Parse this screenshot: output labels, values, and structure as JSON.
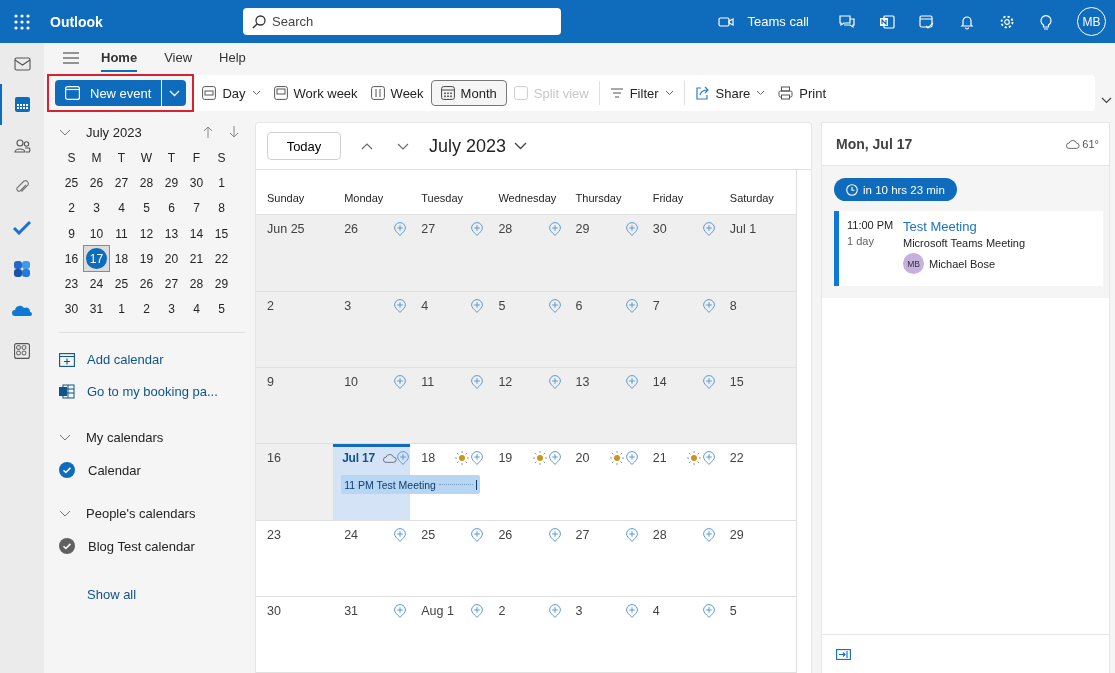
{
  "app": {
    "name": "Outlook"
  },
  "search": {
    "placeholder": "Search"
  },
  "header": {
    "teams_call": "Teams call",
    "avatar": "MB"
  },
  "rail": [
    {
      "kind": "mail",
      "selected": false
    },
    {
      "kind": "calendar",
      "selected": true
    },
    {
      "kind": "people",
      "selected": false
    },
    {
      "kind": "attach",
      "selected": false
    },
    {
      "kind": "todo",
      "selected": false
    },
    {
      "kind": "office",
      "selected": false
    },
    {
      "kind": "cloud",
      "selected": false
    },
    {
      "kind": "apps",
      "selected": false
    }
  ],
  "ribbon_tabs": [
    {
      "label": "Home",
      "selected": true
    },
    {
      "label": "View",
      "selected": false
    },
    {
      "label": "Help",
      "selected": false
    }
  ],
  "new_event": {
    "label": "New event",
    "highlighted": true
  },
  "toolbar": [
    {
      "kind": "day",
      "label": "Day",
      "dropdown": true,
      "selected": false,
      "disabled": false
    },
    {
      "kind": "workweek",
      "label": "Work week",
      "dropdown": false,
      "selected": false,
      "disabled": false
    },
    {
      "kind": "week",
      "label": "Week",
      "dropdown": false,
      "selected": false,
      "disabled": false
    },
    {
      "kind": "month",
      "label": "Month",
      "dropdown": false,
      "selected": true,
      "disabled": false
    },
    {
      "kind": "split",
      "label": "Split view",
      "dropdown": false,
      "selected": false,
      "disabled": true
    },
    {
      "kind": "filter",
      "label": "Filter",
      "dropdown": true,
      "selected": false,
      "disabled": false
    },
    {
      "kind": "share",
      "label": "Share",
      "dropdown": true,
      "selected": false,
      "disabled": false
    },
    {
      "kind": "print",
      "label": "Print",
      "dropdown": false,
      "selected": false,
      "disabled": false
    }
  ],
  "mini_calendar": {
    "title": "July 2023",
    "weekdays": [
      "S",
      "M",
      "T",
      "W",
      "T",
      "F",
      "S"
    ],
    "weeks": [
      [
        {
          "label": "25",
          "selected": false
        },
        {
          "label": "26",
          "selected": false
        },
        {
          "label": "27",
          "selected": false
        },
        {
          "label": "28",
          "selected": false
        },
        {
          "label": "29",
          "selected": false
        },
        {
          "label": "30",
          "selected": false
        },
        {
          "label": "1",
          "selected": false
        }
      ],
      [
        {
          "label": "2",
          "selected": false
        },
        {
          "label": "3",
          "selected": false
        },
        {
          "label": "4",
          "selected": false
        },
        {
          "label": "5",
          "selected": false
        },
        {
          "label": "6",
          "selected": false
        },
        {
          "label": "7",
          "selected": false
        },
        {
          "label": "8",
          "selected": false
        }
      ],
      [
        {
          "label": "9",
          "selected": false
        },
        {
          "label": "10",
          "selected": false
        },
        {
          "label": "11",
          "selected": false
        },
        {
          "label": "12",
          "selected": false
        },
        {
          "label": "13",
          "selected": false
        },
        {
          "label": "14",
          "selected": false
        },
        {
          "label": "15",
          "selected": false
        }
      ],
      [
        {
          "label": "16",
          "selected": false
        },
        {
          "label": "17",
          "selected": true
        },
        {
          "label": "18",
          "selected": false
        },
        {
          "label": "19",
          "selected": false
        },
        {
          "label": "20",
          "selected": false
        },
        {
          "label": "21",
          "selected": false
        },
        {
          "label": "22",
          "selected": false
        }
      ],
      [
        {
          "label": "23",
          "selected": false
        },
        {
          "label": "24",
          "selected": false
        },
        {
          "label": "25",
          "selected": false
        },
        {
          "label": "26",
          "selected": false
        },
        {
          "label": "27",
          "selected": false
        },
        {
          "label": "28",
          "selected": false
        },
        {
          "label": "29",
          "selected": false
        }
      ],
      [
        {
          "label": "30",
          "selected": false
        },
        {
          "label": "31",
          "selected": false
        },
        {
          "label": "1",
          "selected": false
        },
        {
          "label": "2",
          "selected": false
        },
        {
          "label": "3",
          "selected": false
        },
        {
          "label": "4",
          "selected": false
        },
        {
          "label": "5",
          "selected": false
        }
      ]
    ]
  },
  "links": [
    {
      "kind": "add",
      "label": "Add calendar"
    },
    {
      "kind": "booking",
      "label": "Go to my booking pa..."
    }
  ],
  "calendar_groups": [
    {
      "title": "My calendars",
      "expanded": true,
      "calendars": [
        {
          "name": "Calendar",
          "checked": true,
          "color": "#0f6cbd"
        }
      ]
    },
    {
      "title": "People's calendars",
      "expanded": true,
      "calendars": [
        {
          "name": "Blog Test calendar",
          "checked": true,
          "color": "#616161"
        }
      ]
    }
  ],
  "show_all": "Show all",
  "month_view": {
    "today_button": "Today",
    "title": "July 2023",
    "day_headers": [
      "Sunday",
      "Monday",
      "Tuesday",
      "Wednesday",
      "Thursday",
      "Friday",
      "Saturday"
    ],
    "weeks": [
      [
        {
          "label": "Jun 25",
          "past": true,
          "today": false
        },
        {
          "label": "26",
          "past": true,
          "today": false
        },
        {
          "label": "27",
          "past": true,
          "today": false
        },
        {
          "label": "28",
          "past": true,
          "today": false
        },
        {
          "label": "29",
          "past": true,
          "today": false
        },
        {
          "label": "30",
          "past": true,
          "today": false
        },
        {
          "label": "Jul 1",
          "past": true,
          "today": false
        }
      ],
      [
        {
          "label": "2",
          "past": true,
          "today": false
        },
        {
          "label": "3",
          "past": true,
          "today": false
        },
        {
          "label": "4",
          "past": true,
          "today": false
        },
        {
          "label": "5",
          "past": true,
          "today": false
        },
        {
          "label": "6",
          "past": true,
          "today": false
        },
        {
          "label": "7",
          "past": true,
          "today": false
        },
        {
          "label": "8",
          "past": true,
          "today": false
        }
      ],
      [
        {
          "label": "9",
          "past": true,
          "today": false
        },
        {
          "label": "10",
          "past": true,
          "today": false
        },
        {
          "label": "11",
          "past": true,
          "today": false
        },
        {
          "label": "12",
          "past": true,
          "today": false
        },
        {
          "label": "13",
          "past": true,
          "today": false
        },
        {
          "label": "14",
          "past": true,
          "today": false
        },
        {
          "label": "15",
          "past": true,
          "today": false
        }
      ],
      [
        {
          "label": "16",
          "past": true,
          "today": false
        },
        {
          "label": "Jul 17",
          "past": false,
          "today": true,
          "weather": {
            "kind": "cloudy"
          },
          "events": [
            {
              "text": "11 PM Test Meeting",
              "overnight": true
            }
          ]
        },
        {
          "label": "18",
          "past": false,
          "today": false,
          "weather": {
            "kind": "sunny"
          }
        },
        {
          "label": "19",
          "past": false,
          "today": false,
          "weather": {
            "kind": "sunny"
          }
        },
        {
          "label": "20",
          "past": false,
          "today": false,
          "weather": {
            "kind": "sunny"
          }
        },
        {
          "label": "21",
          "past": false,
          "today": false,
          "weather": {
            "kind": "sunny"
          }
        },
        {
          "label": "22",
          "past": false,
          "today": false
        }
      ],
      [
        {
          "label": "23",
          "past": false,
          "today": false
        },
        {
          "label": "24",
          "past": false,
          "today": false
        },
        {
          "label": "25",
          "past": false,
          "today": false
        },
        {
          "label": "26",
          "past": false,
          "today": false
        },
        {
          "label": "27",
          "past": false,
          "today": false
        },
        {
          "label": "28",
          "past": false,
          "today": false
        },
        {
          "label": "29",
          "past": false,
          "today": false
        }
      ],
      [
        {
          "label": "30",
          "past": false,
          "today": false
        },
        {
          "label": "31",
          "past": false,
          "today": false
        },
        {
          "label": "Aug 1",
          "past": false,
          "today": false
        },
        {
          "label": "2",
          "past": false,
          "today": false
        },
        {
          "label": "3",
          "past": false,
          "today": false
        },
        {
          "label": "4",
          "past": false,
          "today": false
        },
        {
          "label": "5",
          "past": false,
          "today": false
        }
      ]
    ]
  },
  "agenda": {
    "date": "Mon, Jul 17",
    "temperature": "61°",
    "countdown": "in 10 hrs 23 min",
    "events": [
      {
        "time": "11:00 PM",
        "duration": "1 day",
        "title": "Test Meeting",
        "subtitle": "Microsoft Teams Meeting",
        "organizer_initials": "MB",
        "organizer": "Michael Bose"
      }
    ]
  }
}
